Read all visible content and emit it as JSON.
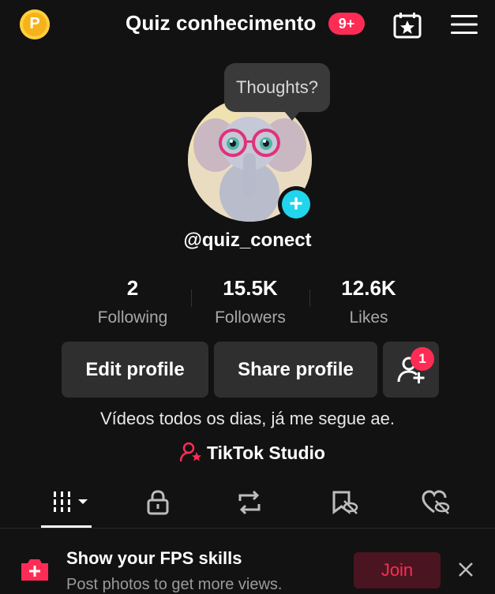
{
  "header": {
    "coin_letter": "P",
    "title": "Quiz conhecimento",
    "notification_badge": "9+",
    "calendar_icon": "calendar-star-icon",
    "menu_icon": "hamburger-menu-icon"
  },
  "profile": {
    "bubble_text": "Thoughts?",
    "username": "@quiz_conect",
    "avatar_add_icon": "plus-icon"
  },
  "stats": [
    {
      "value": "2",
      "label": "Following"
    },
    {
      "value": "15.5K",
      "label": "Followers"
    },
    {
      "value": "12.6K",
      "label": "Likes"
    }
  ],
  "actions": {
    "edit_profile": "Edit profile",
    "share_profile": "Share profile",
    "add_friends_badge": "1"
  },
  "bio": "Vídeos todos os dias, já me segue ae.",
  "studio_link": "TikTok Studio",
  "tabs": [
    {
      "icon": "videos-grid-icon",
      "active": true
    },
    {
      "icon": "lock-icon"
    },
    {
      "icon": "repost-icon"
    },
    {
      "icon": "bookmark-hidden-icon"
    },
    {
      "icon": "liked-hidden-icon"
    }
  ],
  "promo": {
    "title": "Show your FPS skills",
    "subtitle": "Post photos to get more views.",
    "join_label": "Join"
  },
  "colors": {
    "background": "#121212",
    "accent": "#fe2c55",
    "cyan": "#20d5ec",
    "coin": "#f6b21a"
  }
}
